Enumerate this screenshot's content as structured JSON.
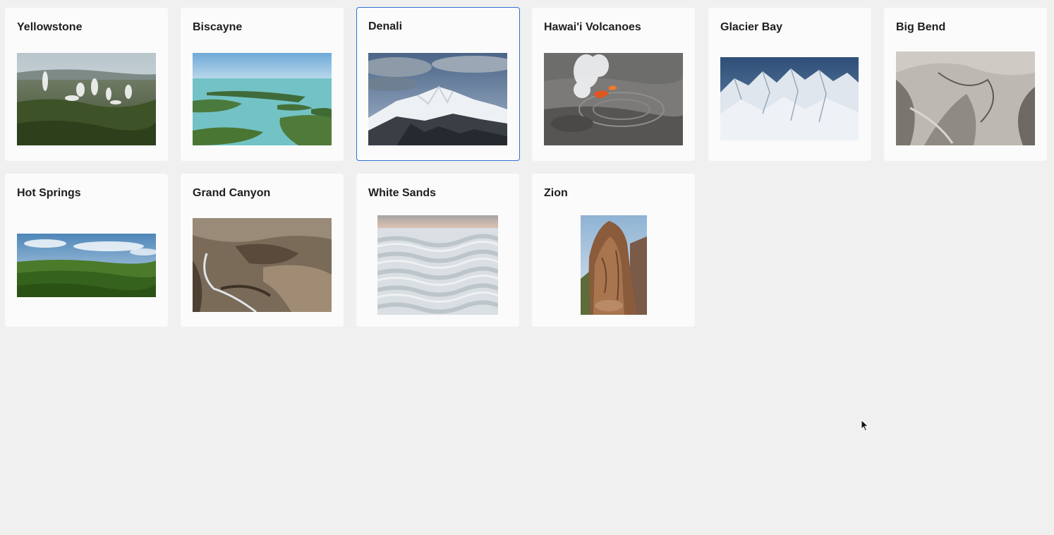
{
  "parks": [
    {
      "name": "Yellowstone",
      "image": "yellowstone-geysers-image"
    },
    {
      "name": "Biscayne",
      "image": "biscayne-bay-image"
    },
    {
      "name": "Denali",
      "image": "denali-mountain-image"
    },
    {
      "name": "Hawai'i Volcanoes",
      "image": "hawaii-volcano-image"
    },
    {
      "name": "Glacier Bay",
      "image": "glacier-bay-mountains-image"
    },
    {
      "name": "Big Bend",
      "image": "big-bend-canyon-image"
    },
    {
      "name": "Hot Springs",
      "image": "hot-springs-forest-image"
    },
    {
      "name": "Grand Canyon",
      "image": "grand-canyon-image"
    },
    {
      "name": "White Sands",
      "image": "white-sands-dunes-image"
    },
    {
      "name": "Zion",
      "image": "zion-cliff-image"
    }
  ],
  "selected_park": "Denali",
  "colors": {
    "background": "#f0f0f0",
    "card": "#fbfbfb",
    "selected_border": "#2e73d1",
    "title": "#1e1e1e"
  }
}
